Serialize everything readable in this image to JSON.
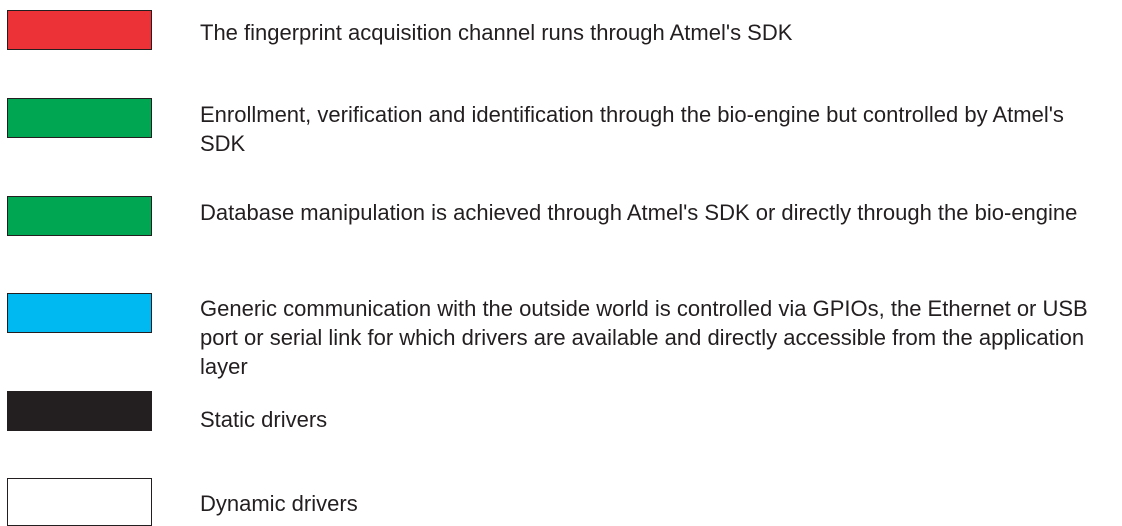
{
  "legend": {
    "items": [
      {
        "color": "#ed3237",
        "label": "The fingerprint acquisition channel runs through Atmel's SDK"
      },
      {
        "color": "#00a651",
        "label": "Enrollment, verification and identification through the bio-engine but controlled by Atmel's SDK"
      },
      {
        "color": "#00a651",
        "label": "Database manipulation is achieved through Atmel's SDK or directly through the bio-engine"
      },
      {
        "color": "#00b9f1",
        "label": "Generic communication with the outside world is controlled via GPIOs, the Ethernet or USB port or serial link for which drivers are available and directly accessible from the application layer"
      },
      {
        "color": "#231f20",
        "label": "Static drivers"
      },
      {
        "color": "#ffffff",
        "label": "Dynamic drivers"
      }
    ]
  }
}
